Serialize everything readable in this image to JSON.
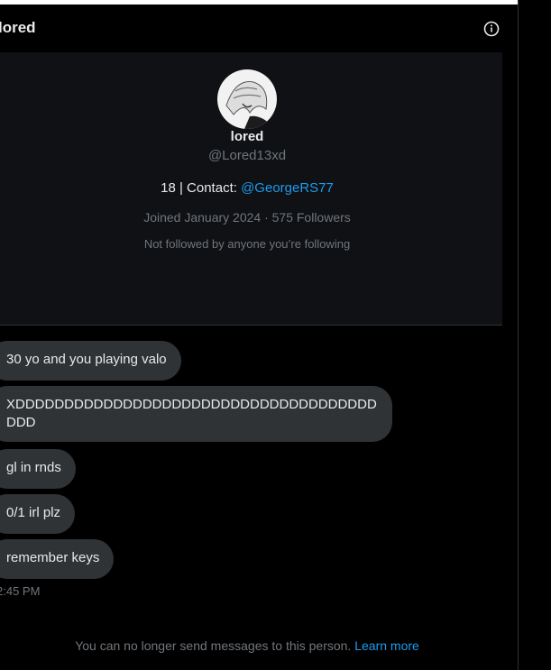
{
  "header": {
    "title": "lored",
    "info_icon": "info-circle-icon"
  },
  "profile": {
    "name": "lored",
    "handle": "@Lored13xd",
    "bio_prefix": "18 | Contact: ",
    "bio_link": "@GeorgeRS77",
    "joined": "Joined January 2024 · 575 Followers",
    "not_followed": "Not followed by anyone you’re following"
  },
  "messages": [
    "30 yo and you playing valo",
    "XDDDDDDDDDDDDDDDDDDDDDDDDDDDDDDDDDDDDDDDD",
    "gl in rnds",
    "0/1 irl plz",
    "remember keys"
  ],
  "last_timestamp": "2:45 PM",
  "footer": {
    "text": "You can no longer send messages to this person. ",
    "link": "Learn more"
  },
  "colors": {
    "accent": "#1d9bf0",
    "bubble": "#2f3336",
    "muted": "#71767b"
  }
}
